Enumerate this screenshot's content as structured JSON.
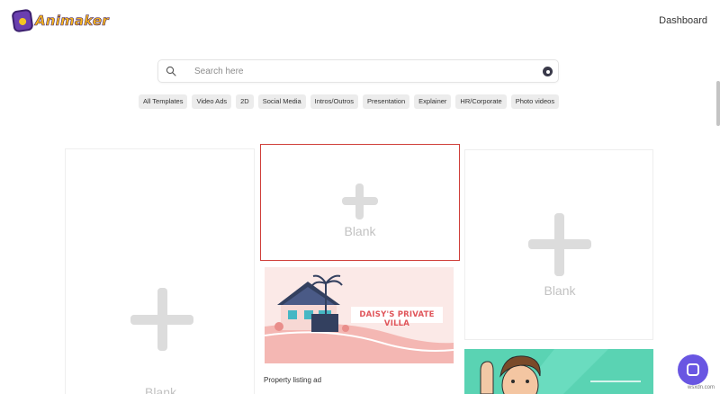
{
  "header": {
    "logo_text": "Animaker",
    "dashboard_label": "Dashboard"
  },
  "search": {
    "placeholder": "Search here",
    "value": ""
  },
  "categories": [
    "All Templates",
    "Video Ads",
    "2D",
    "Social Media",
    "Intros/Outros",
    "Presentation",
    "Explainer",
    "HR/Corporate",
    "Photo videos"
  ],
  "templates": {
    "blank_label": "Blank",
    "property_ad": {
      "caption": "Property listing ad",
      "banner_text": "DAISY'S PRIVATE VILLA"
    }
  },
  "colors": {
    "selected_border": "#d0403b",
    "chat_button": "#6956e2",
    "villa_banner_text": "#e0565b"
  },
  "watermark": "wsxdn.com"
}
